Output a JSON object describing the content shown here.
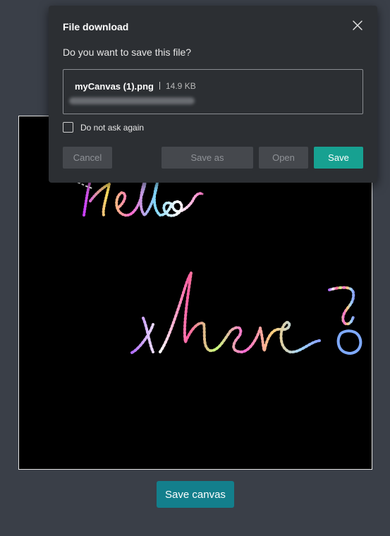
{
  "dialog": {
    "title": "File download",
    "question": "Do you want to save this file?",
    "file_name": "myCanvas (1).png",
    "file_size": "14.9 KB",
    "checkbox_label": "Do not ask again",
    "checkbox_checked": false,
    "buttons": {
      "cancel": "Cancel",
      "save_as": "Save as",
      "open": "Open",
      "save": "Save"
    },
    "icons": {
      "close": "close-icon"
    }
  },
  "canvas": {
    "background": "#000000",
    "drawing_lines": [
      "Hello",
      "there?"
    ]
  },
  "page": {
    "save_canvas_label": "Save canvas"
  },
  "colors": {
    "page_background": "#3a3f48",
    "dialog_background": "#2c2f33",
    "primary_save": "#17a191",
    "save_canvas_button": "#137f8c",
    "muted_button": "#45484d"
  }
}
